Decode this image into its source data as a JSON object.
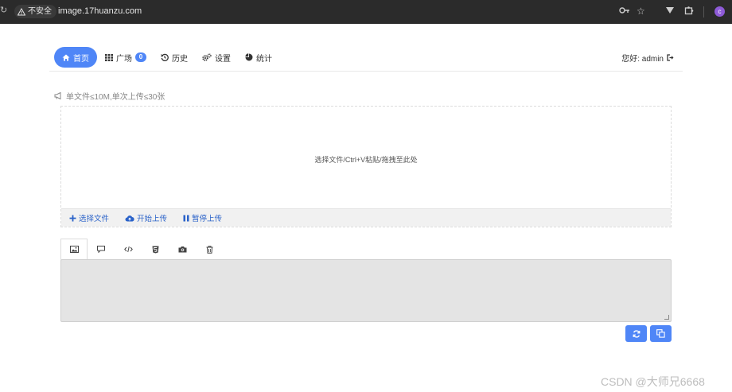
{
  "browser": {
    "security_label": "不安全",
    "url": "image.17huanzu.com",
    "profile_initial": "c"
  },
  "nav": {
    "items": [
      {
        "label": "首页",
        "icon": "home-icon",
        "active": true
      },
      {
        "label": "广场",
        "icon": "grid-icon",
        "badge": "0"
      },
      {
        "label": "历史",
        "icon": "history-icon"
      },
      {
        "label": "设置",
        "icon": "gears-icon"
      },
      {
        "label": "统计",
        "icon": "pie-chart-icon"
      }
    ],
    "greeting": "您好: admin"
  },
  "notice": "单文件≤10M,单次上传≤30张",
  "dropzone": {
    "hint": "选择文件/Ctrl+V粘贴/拖拽至此处",
    "actions": [
      "选择文件",
      "开始上传",
      "暂停上传"
    ]
  },
  "output_tabs": [
    "image-icon",
    "comment-icon",
    "code-icon",
    "html5-icon",
    "camera-icon",
    "trash-icon"
  ],
  "watermark": "CSDN @大师兄6668",
  "colors": {
    "accent": "#4f86f7",
    "link": "#2a62c9"
  }
}
